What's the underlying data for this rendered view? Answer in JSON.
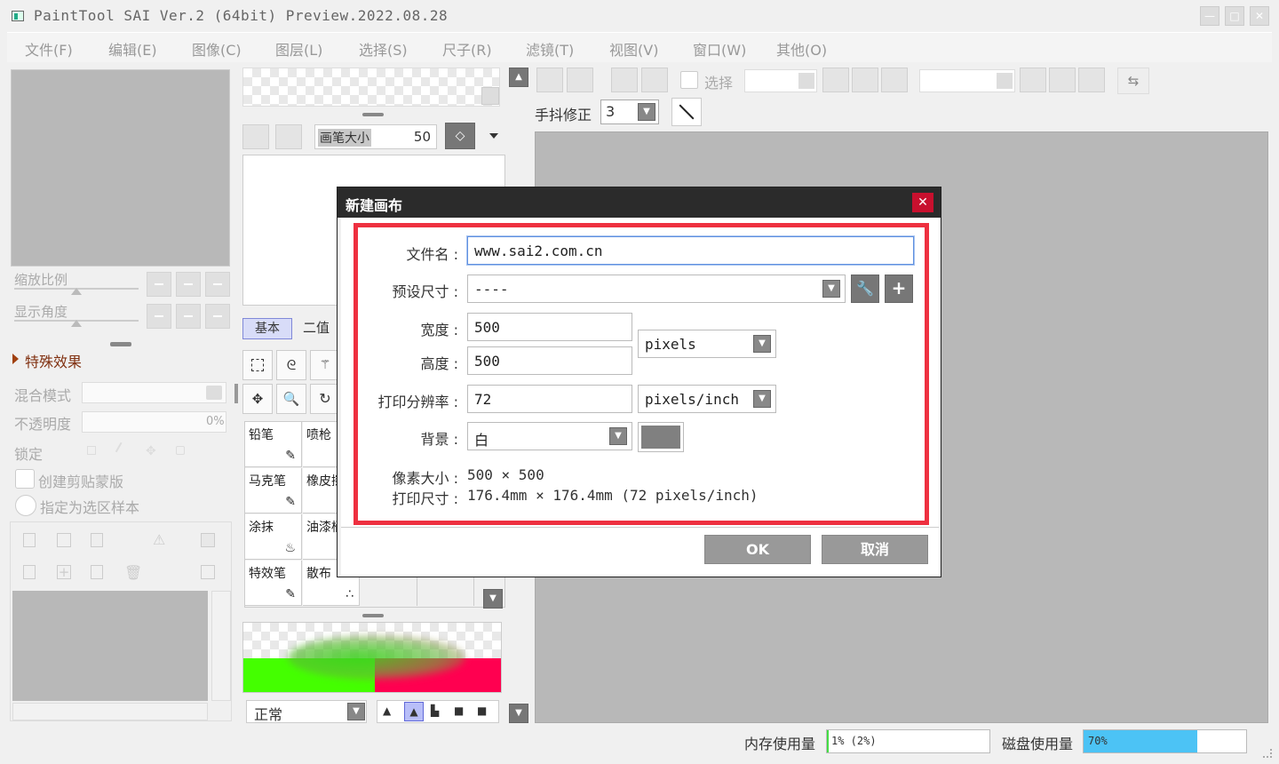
{
  "app": {
    "title": "PaintTool SAI Ver.2 (64bit) Preview.2022.08.28"
  },
  "window_controls": {
    "minimize": "—",
    "maximize": "□",
    "close": "✕"
  },
  "menu": [
    "文件(F)",
    "编辑(E)",
    "图像(C)",
    "图层(L)",
    "选择(S)",
    "尺子(R)",
    "滤镜(T)",
    "视图(V)",
    "窗口(W)",
    "其他(O)"
  ],
  "left_panel": {
    "zoom_label": "缩放比例",
    "angle_label": "显示角度",
    "effects_label": "特殊效果",
    "blend_mode_label": "混合模式",
    "opacity_label": "不透明度",
    "opacity_value": "0%",
    "lock_label": "锁定",
    "clip_mask_label": "创建剪贴蒙版",
    "selection_source_label": "指定为选区样本"
  },
  "brush_panel": {
    "brush_size_label": "画笔大小",
    "brush_size_value": "50",
    "tabs": [
      "基本",
      "二值"
    ],
    "tools": [
      {
        "label": "铅笔",
        "icon": "pencil-icon"
      },
      {
        "label": "喷枪",
        "icon": "airbrush-icon"
      },
      {
        "label": "马克笔",
        "icon": "marker-icon"
      },
      {
        "label": "橡皮擦",
        "icon": "eraser-icon"
      },
      {
        "label": "涂抹",
        "icon": "blur-icon"
      },
      {
        "label": "油漆桶",
        "icon": "bucket-icon"
      },
      {
        "label": "特效笔",
        "icon": "fx-pen-icon"
      },
      {
        "label": "散布",
        "icon": "scatter-icon"
      }
    ],
    "blend_value": "正常"
  },
  "toolbar": {
    "select_label": "选择",
    "stabilizer_label": "手抖修正",
    "stabilizer_value": "3"
  },
  "dialog": {
    "title": "新建画布",
    "filename_label": "文件名 :",
    "filename_value": "www.sai2.com.cn",
    "preset_label": "预设尺寸 :",
    "preset_value": "----",
    "width_label": "宽度 :",
    "width_value": "500",
    "height_label": "高度 :",
    "height_value": "500",
    "size_unit": "pixels",
    "resolution_label": "打印分辨率 :",
    "resolution_value": "72",
    "resolution_unit": "pixels/inch",
    "background_label": "背景 :",
    "background_value": "白",
    "pixel_size_label": "像素大小 :",
    "pixel_size_value": "500 × 500",
    "print_size_label": "打印尺寸 :",
    "print_size_value": "176.4mm × 176.4mm (72 pixels/inch)",
    "ok_label": "OK",
    "cancel_label": "取消"
  },
  "status": {
    "memory_label": "内存使用量",
    "memory_value": "1% (2%)",
    "memory_fraction": 0.01,
    "disk_label": "磁盘使用量",
    "disk_value": "70%",
    "disk_fraction": 0.7
  },
  "colors": {
    "accent_red": "#ee3040",
    "disk_bar": "#4cc3f5",
    "green": "#44ff00",
    "pink": "#ff0050",
    "close_red": "#c8102e"
  }
}
